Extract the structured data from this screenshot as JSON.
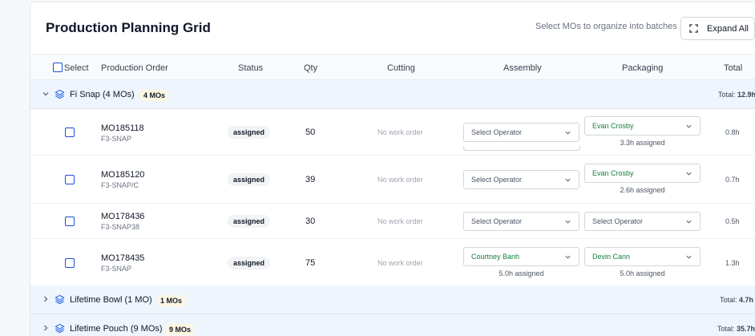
{
  "page": {
    "title": "Production Planning Grid",
    "hint": "Select MOs to organize into batches",
    "expand_all_label": "Expand All"
  },
  "colors": {
    "accent": "#1d4ed8",
    "assigned_green": "#15803d",
    "group_bg": "#eef5fc",
    "mo_badge_bg": "#fdf6e3"
  },
  "table": {
    "headers": {
      "select": "Select",
      "production_order": "Production Order",
      "status": "Status",
      "qty": "Qty",
      "cutting": "Cutting",
      "assembly": "Assembly",
      "packaging": "Packaging",
      "total": "Total"
    }
  },
  "groups": [
    {
      "name": "Fi Snap (4 MOs)",
      "badge": "4 MOs",
      "total_label": "Total:",
      "total_value": "12.9h",
      "expanded": true,
      "rows": [
        {
          "mo": "MO185118",
          "sku": "F3-SNAP",
          "status": "assigned",
          "qty": "50",
          "cutting": "No work order",
          "assembly": "Select Operator",
          "assembly_assigned": "",
          "packaging": "Evan Crosby",
          "packaging_assigned": "3.3h assigned",
          "total": "0.8h"
        },
        {
          "mo": "MO185120",
          "sku": "F3-SNAP/C",
          "status": "assigned",
          "qty": "39",
          "cutting": "No work order",
          "assembly": "Select Operator",
          "assembly_assigned": "",
          "packaging": "Evan Crosby",
          "packaging_assigned": "2.6h assigned",
          "total": "0.7h"
        },
        {
          "mo": "MO178436",
          "sku": "F3-SNAP38",
          "status": "assigned",
          "qty": "30",
          "cutting": "No work order",
          "assembly": "Select Operator",
          "assembly_assigned": "",
          "packaging": "Select Operator",
          "packaging_assigned": "",
          "total": "0.5h"
        },
        {
          "mo": "MO178435",
          "sku": "F3-SNAP",
          "status": "assigned",
          "qty": "75",
          "cutting": "No work order",
          "assembly": "Courtney Banh",
          "assembly_assigned": "5.0h assigned",
          "packaging": "Devin Cann",
          "packaging_assigned": "5.0h assigned",
          "total": "1.3h"
        }
      ]
    },
    {
      "name": "Lifetime Bowl (1 MO)",
      "badge": "1 MOs",
      "total_label": "Total:",
      "total_value": "4.7h",
      "expanded": false
    },
    {
      "name": "Lifetime Pouch (9 MOs)",
      "badge": "9 MOs",
      "total_label": "Total:",
      "total_value": "35.7h",
      "expanded": false
    }
  ]
}
